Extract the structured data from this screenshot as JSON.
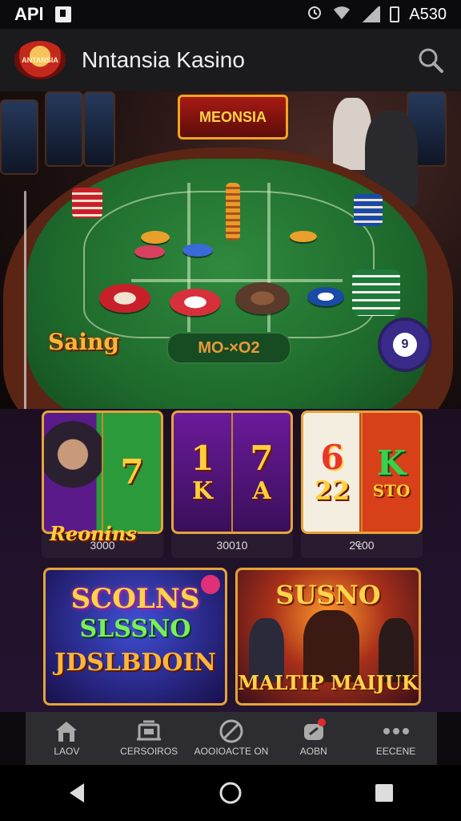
{
  "status_bar": {
    "left_text": "APl",
    "time": "A530"
  },
  "app_bar": {
    "logo_text": "ANTANSIA",
    "title": "Nntansia Kasino"
  },
  "hero": {
    "sign_text": "MEONSIA",
    "label": "Saing",
    "plaque_text": "MO-×O2",
    "fab_label": "9"
  },
  "slots": [
    {
      "reel1": "7",
      "reel2": "",
      "caption": "Reonins",
      "value": "3000"
    },
    {
      "reel1": "1",
      "reel1b": "K",
      "reel2": "7",
      "reel2b": "A",
      "value": "30010"
    },
    {
      "reel1": "6",
      "reel1b": "22",
      "reel2": "K",
      "reel2b": "STO",
      "value": "2₠00"
    }
  ],
  "promos": [
    {
      "line1": "SCOLNS",
      "line2": "SLSSNO",
      "line3": "JDSLBDOIN"
    },
    {
      "line1": "SUSNO",
      "line2": "MALTIP MAIJUK"
    }
  ],
  "bottom_nav": {
    "items": [
      {
        "label": "LAOV",
        "icon": "home-icon"
      },
      {
        "label": "CERSOIROS",
        "icon": "slot-machine-icon"
      },
      {
        "label": "AOOIOACTE ON",
        "icon": "roulette-icon"
      },
      {
        "label": "AOBN",
        "icon": "wallet-icon"
      },
      {
        "label": "EECENE",
        "icon": "more-icon"
      }
    ]
  },
  "colors": {
    "accent_gold": "#e6a33a",
    "felt_green": "#1e6a2c",
    "nav_bg": "#2d2c31"
  }
}
